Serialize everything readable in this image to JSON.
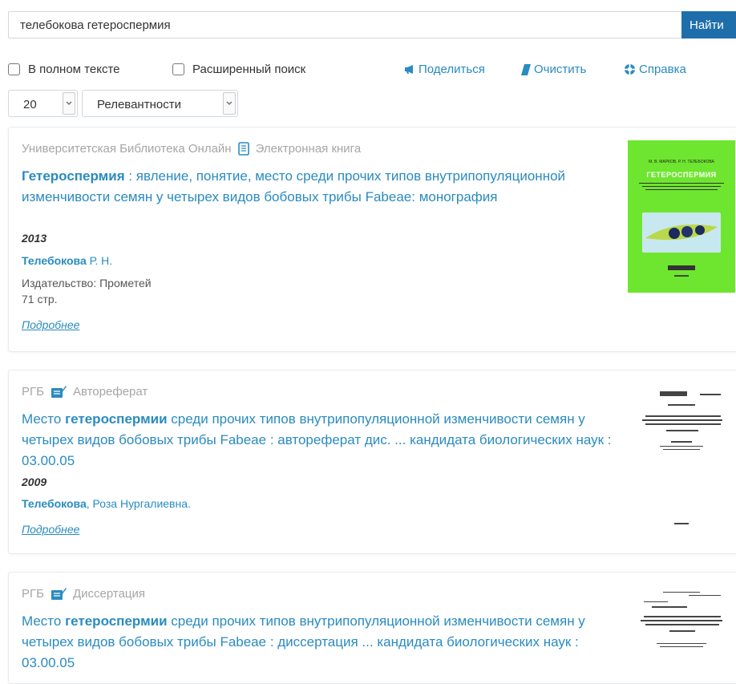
{
  "search": {
    "value": "телебокова гетероспермия",
    "button_label": "Найти"
  },
  "options": {
    "fulltext_label": "В полном тексте",
    "advanced_label": "Расширенный поиск",
    "share_label": "Поделиться",
    "clear_label": "Очистить",
    "help_label": "Справка"
  },
  "controls": {
    "per_page": "20",
    "sort": "Релевантности"
  },
  "results": [
    {
      "source": "Университетская Библиотека Онлайн",
      "type": "Электронная книга",
      "title_bold": "Гетероспермия",
      "title_rest": " : явление, понятие, место среди прочих типов внутрипопуляционной изменчивости семян у четырех видов бобовых трибы Fabeae: монография",
      "year": "2013",
      "author_bold": "Телебокова",
      "author_rest": " Р. Н.",
      "publisher": "Издательство: Прометей",
      "pages": "71 стр.",
      "more": "Подробнее",
      "cover_authors": "М. В. МАРКОВ, Р. Н. ТЕЛЕБОКОВА",
      "cover_title": "ГЕТЕРОСПЕРМИЯ"
    },
    {
      "source": "РГБ",
      "type": "Автореферат",
      "title_pre": "Место ",
      "title_bold": "гетероспермии",
      "title_rest": " среди прочих типов внутрипопуляционной изменчивости семян у четырех видов бобовых трибы Fabeae : автореферат дис. ... кандидата биологических наук : 03.00.05",
      "year": "2009",
      "author_bold": "Телебокова",
      "author_rest": ", Роза Нургалиевна.",
      "more": "Подробнее"
    },
    {
      "source": "РГБ",
      "type": "Диссертация",
      "title_pre": "Место ",
      "title_bold": "гетероспермии",
      "title_rest": " среди прочих типов внутрипопуляционной изменчивости семян у четырех видов бобовых трибы Fabeae : диссертация ... кандидата биологических наук : 03.00.05"
    }
  ]
}
